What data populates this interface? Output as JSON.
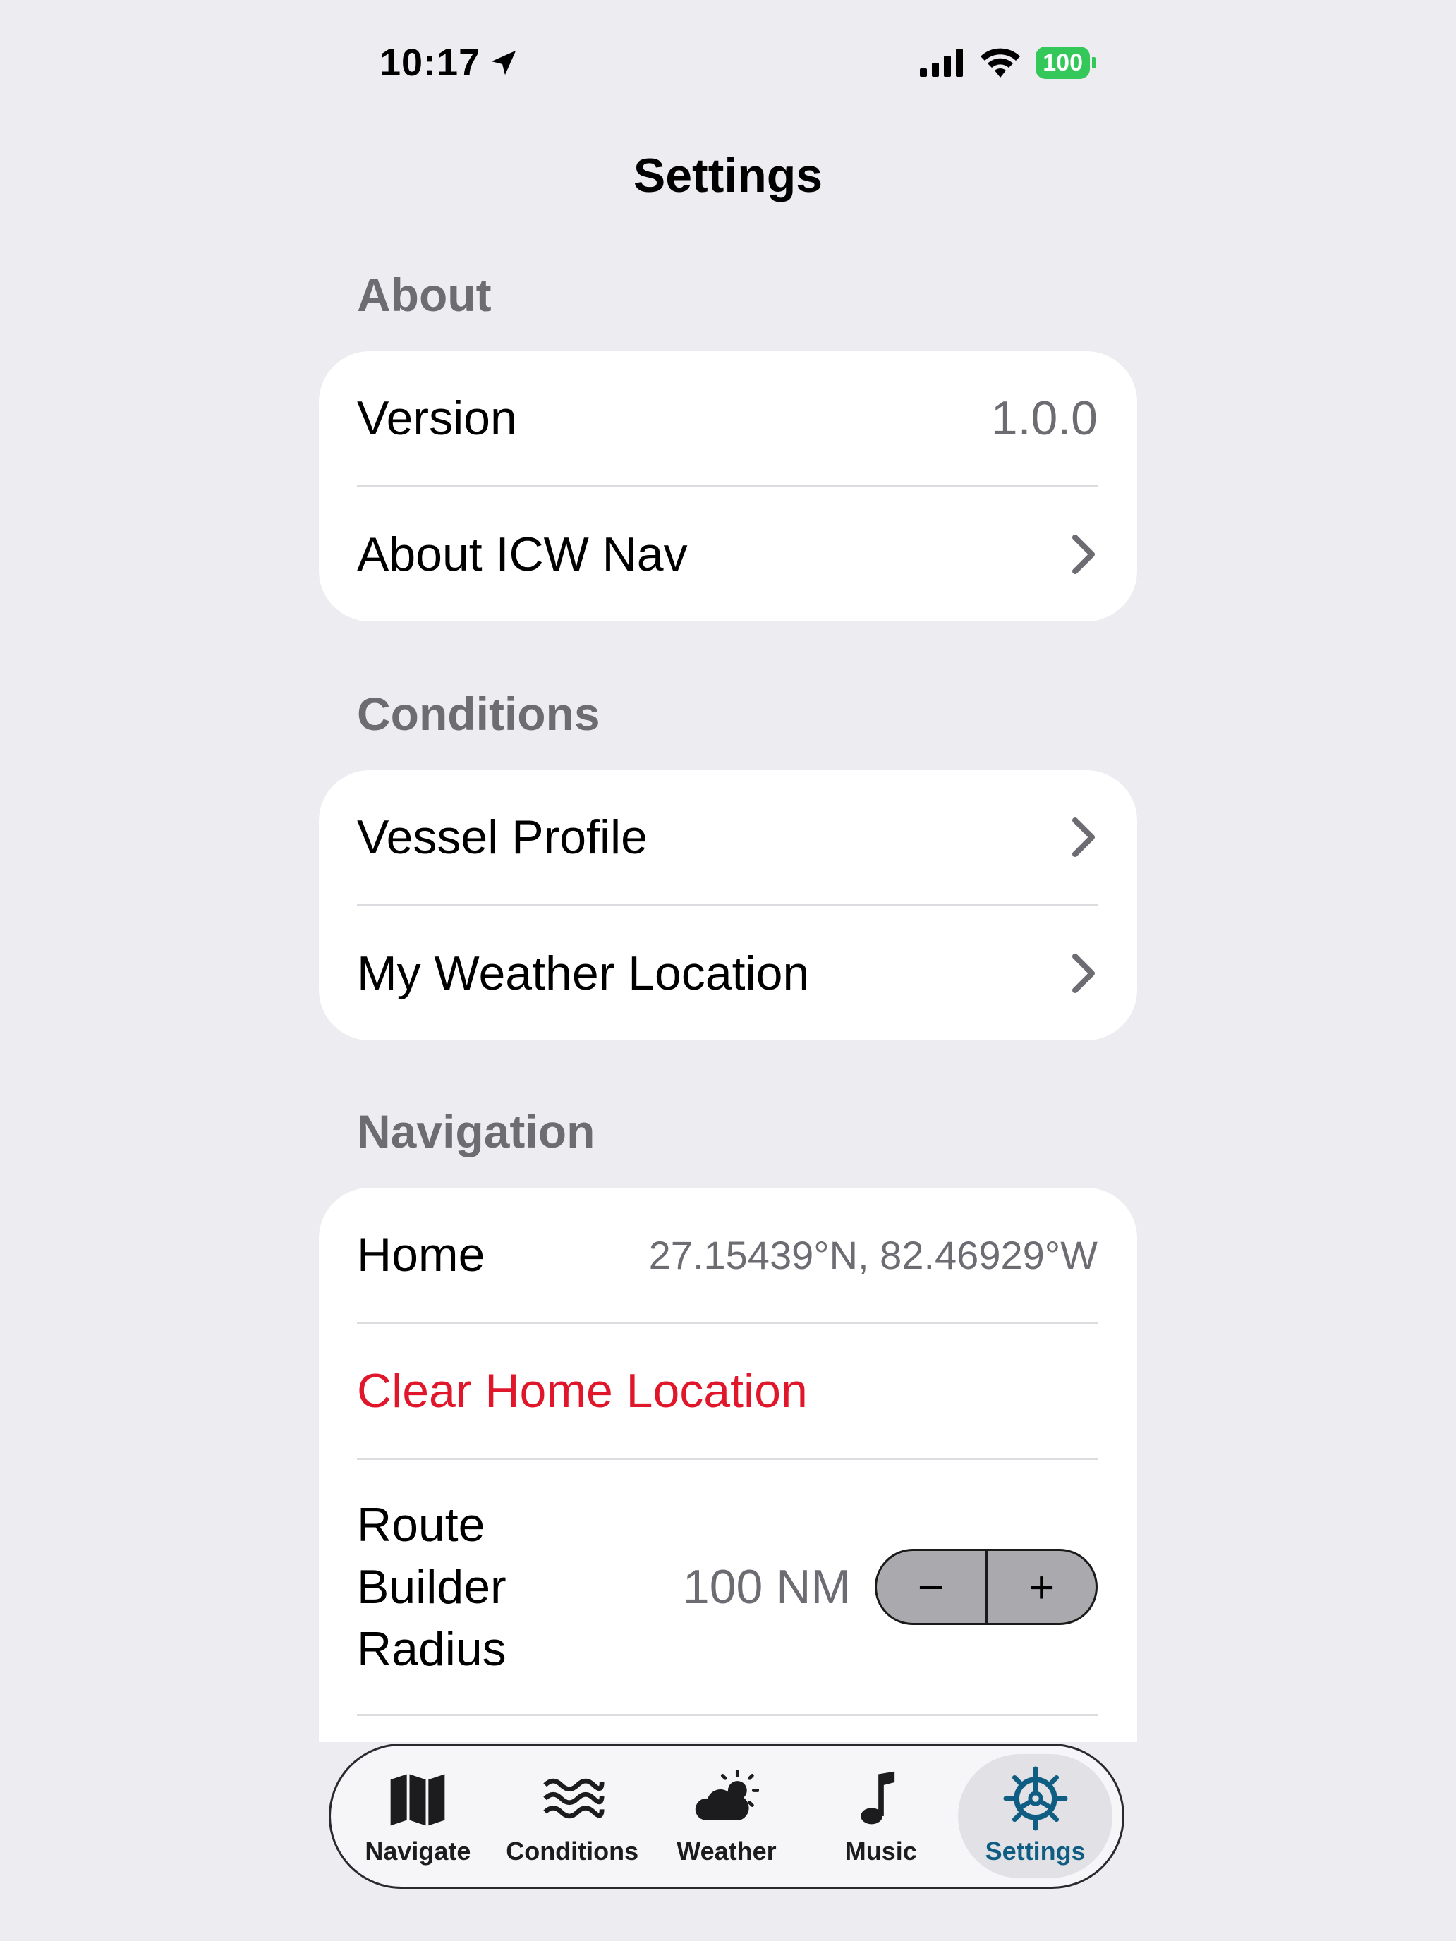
{
  "status_bar": {
    "time": "10:17",
    "battery": "100"
  },
  "title": "Settings",
  "sections": {
    "about": {
      "header": "About",
      "version_label": "Version",
      "version_value": "1.0.0",
      "about_label": "About ICW Nav"
    },
    "conditions": {
      "header": "Conditions",
      "vessel_profile_label": "Vessel Profile",
      "weather_location_label": "My Weather Location"
    },
    "navigation": {
      "header": "Navigation",
      "home_label": "Home",
      "home_value": "27.15439°N, 82.46929°W",
      "clear_home_label": "Clear Home Location",
      "radius_label": "Route Builder Radius",
      "radius_value": "100 NM",
      "stepper_minus": "−",
      "stepper_plus": "+"
    }
  },
  "tabs": [
    {
      "label": "Navigate",
      "icon": "map-icon"
    },
    {
      "label": "Conditions",
      "icon": "waves-icon"
    },
    {
      "label": "Weather",
      "icon": "cloud-sun-icon"
    },
    {
      "label": "Music",
      "icon": "music-note-icon"
    },
    {
      "label": "Settings",
      "icon": "ship-wheel-icon",
      "active": true
    }
  ],
  "colors": {
    "accent": "#0f5d82",
    "destructive": "#e0172a",
    "background": "#ececf1",
    "battery": "#34c759"
  }
}
